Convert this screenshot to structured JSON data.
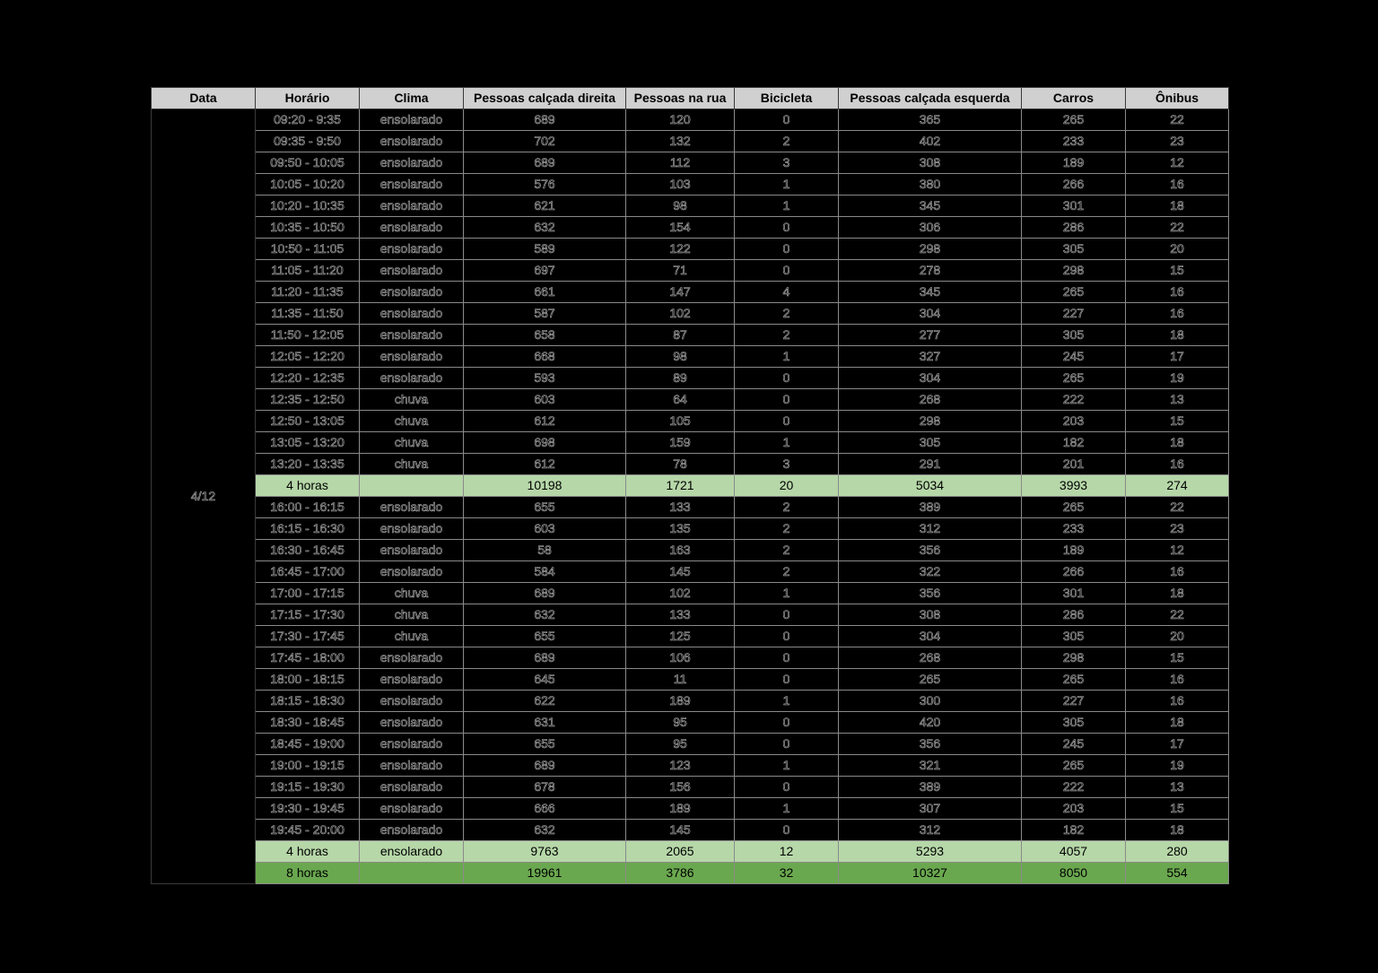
{
  "headers": [
    "Data",
    "Horário",
    "Clima",
    "Pessoas calçada direita",
    "Pessoas na rua",
    "Bicicleta",
    "Pessoas calçada esquerda",
    "Carros",
    "Ônibus"
  ],
  "date": "4/12",
  "period1": [
    [
      "09:20 - 9:35",
      "ensolarado",
      "689",
      "120",
      "0",
      "365",
      "265",
      "22"
    ],
    [
      "09:35 - 9:50",
      "ensolarado",
      "702",
      "132",
      "2",
      "402",
      "233",
      "23"
    ],
    [
      "09:50 - 10:05",
      "ensolarado",
      "689",
      "112",
      "3",
      "308",
      "189",
      "12"
    ],
    [
      "10:05 - 10:20",
      "ensolarado",
      "576",
      "103",
      "1",
      "380",
      "266",
      "16"
    ],
    [
      "10:20 - 10:35",
      "ensolarado",
      "621",
      "98",
      "1",
      "345",
      "301",
      "18"
    ],
    [
      "10:35 - 10:50",
      "ensolarado",
      "632",
      "154",
      "0",
      "306",
      "286",
      "22"
    ],
    [
      "10:50 - 11:05",
      "ensolarado",
      "589",
      "122",
      "0",
      "298",
      "305",
      "20"
    ],
    [
      "11:05 - 11:20",
      "ensolarado",
      "697",
      "71",
      "0",
      "278",
      "298",
      "15"
    ],
    [
      "11:20 - 11:35",
      "ensolarado",
      "661",
      "147",
      "4",
      "345",
      "265",
      "16"
    ],
    [
      "11:35 - 11:50",
      "ensolarado",
      "587",
      "102",
      "2",
      "304",
      "227",
      "16"
    ],
    [
      "11:50 - 12:05",
      "ensolarado",
      "658",
      "87",
      "2",
      "277",
      "305",
      "18"
    ],
    [
      "12:05 - 12:20",
      "ensolarado",
      "668",
      "98",
      "1",
      "327",
      "245",
      "17"
    ],
    [
      "12:20 - 12:35",
      "ensolarado",
      "593",
      "89",
      "0",
      "304",
      "265",
      "19"
    ],
    [
      "12:35 - 12:50",
      "chuva",
      "603",
      "64",
      "0",
      "268",
      "222",
      "13"
    ],
    [
      "12:50 - 13:05",
      "chuva",
      "612",
      "105",
      "0",
      "298",
      "203",
      "15"
    ],
    [
      "13:05 - 13:20",
      "chuva",
      "698",
      "159",
      "1",
      "305",
      "182",
      "18"
    ],
    [
      "13:20 - 13:35",
      "chuva",
      "612",
      "78",
      "3",
      "291",
      "201",
      "16"
    ]
  ],
  "subtotal1": [
    "4 horas",
    "",
    "10198",
    "1721",
    "20",
    "5034",
    "3993",
    "274"
  ],
  "period2": [
    [
      "16:00 - 16:15",
      "ensolarado",
      "655",
      "133",
      "2",
      "389",
      "265",
      "22"
    ],
    [
      "16:15 - 16:30",
      "ensolarado",
      "603",
      "135",
      "2",
      "312",
      "233",
      "23"
    ],
    [
      "16:30 - 16:45",
      "ensolarado",
      "58",
      "163",
      "2",
      "356",
      "189",
      "12"
    ],
    [
      "16:45 - 17:00",
      "ensolarado",
      "584",
      "145",
      "2",
      "322",
      "266",
      "16"
    ],
    [
      "17:00 - 17:15",
      "chuva",
      "689",
      "102",
      "1",
      "356",
      "301",
      "18"
    ],
    [
      "17:15 - 17:30",
      "chuva",
      "632",
      "133",
      "0",
      "308",
      "286",
      "22"
    ],
    [
      "17:30 - 17:45",
      "chuva",
      "655",
      "125",
      "0",
      "304",
      "305",
      "20"
    ],
    [
      "17:45 - 18:00",
      "ensolarado",
      "689",
      "106",
      "0",
      "268",
      "298",
      "15"
    ],
    [
      "18:00 - 18:15",
      "ensolarado",
      "645",
      "11",
      "0",
      "265",
      "265",
      "16"
    ],
    [
      "18:15 - 18:30",
      "ensolarado",
      "622",
      "189",
      "1",
      "300",
      "227",
      "16"
    ],
    [
      "18:30 - 18:45",
      "ensolarado",
      "631",
      "95",
      "0",
      "420",
      "305",
      "18"
    ],
    [
      "18:45 - 19:00",
      "ensolarado",
      "655",
      "95",
      "0",
      "356",
      "245",
      "17"
    ],
    [
      "19:00 - 19:15",
      "ensolarado",
      "689",
      "123",
      "1",
      "321",
      "265",
      "19"
    ],
    [
      "19:15 - 19:30",
      "ensolarado",
      "678",
      "156",
      "0",
      "389",
      "222",
      "13"
    ],
    [
      "19:30 - 19:45",
      "ensolarado",
      "666",
      "189",
      "1",
      "307",
      "203",
      "15"
    ],
    [
      "19:45 - 20:00",
      "ensolarado",
      "632",
      "145",
      "0",
      "312",
      "182",
      "18"
    ]
  ],
  "subtotal2": [
    "4 horas",
    "ensolarado",
    "9763",
    "2065",
    "12",
    "5293",
    "4057",
    "280"
  ],
  "total": [
    "8 horas",
    "",
    "19961",
    "3786",
    "32",
    "10327",
    "8050",
    "554"
  ]
}
